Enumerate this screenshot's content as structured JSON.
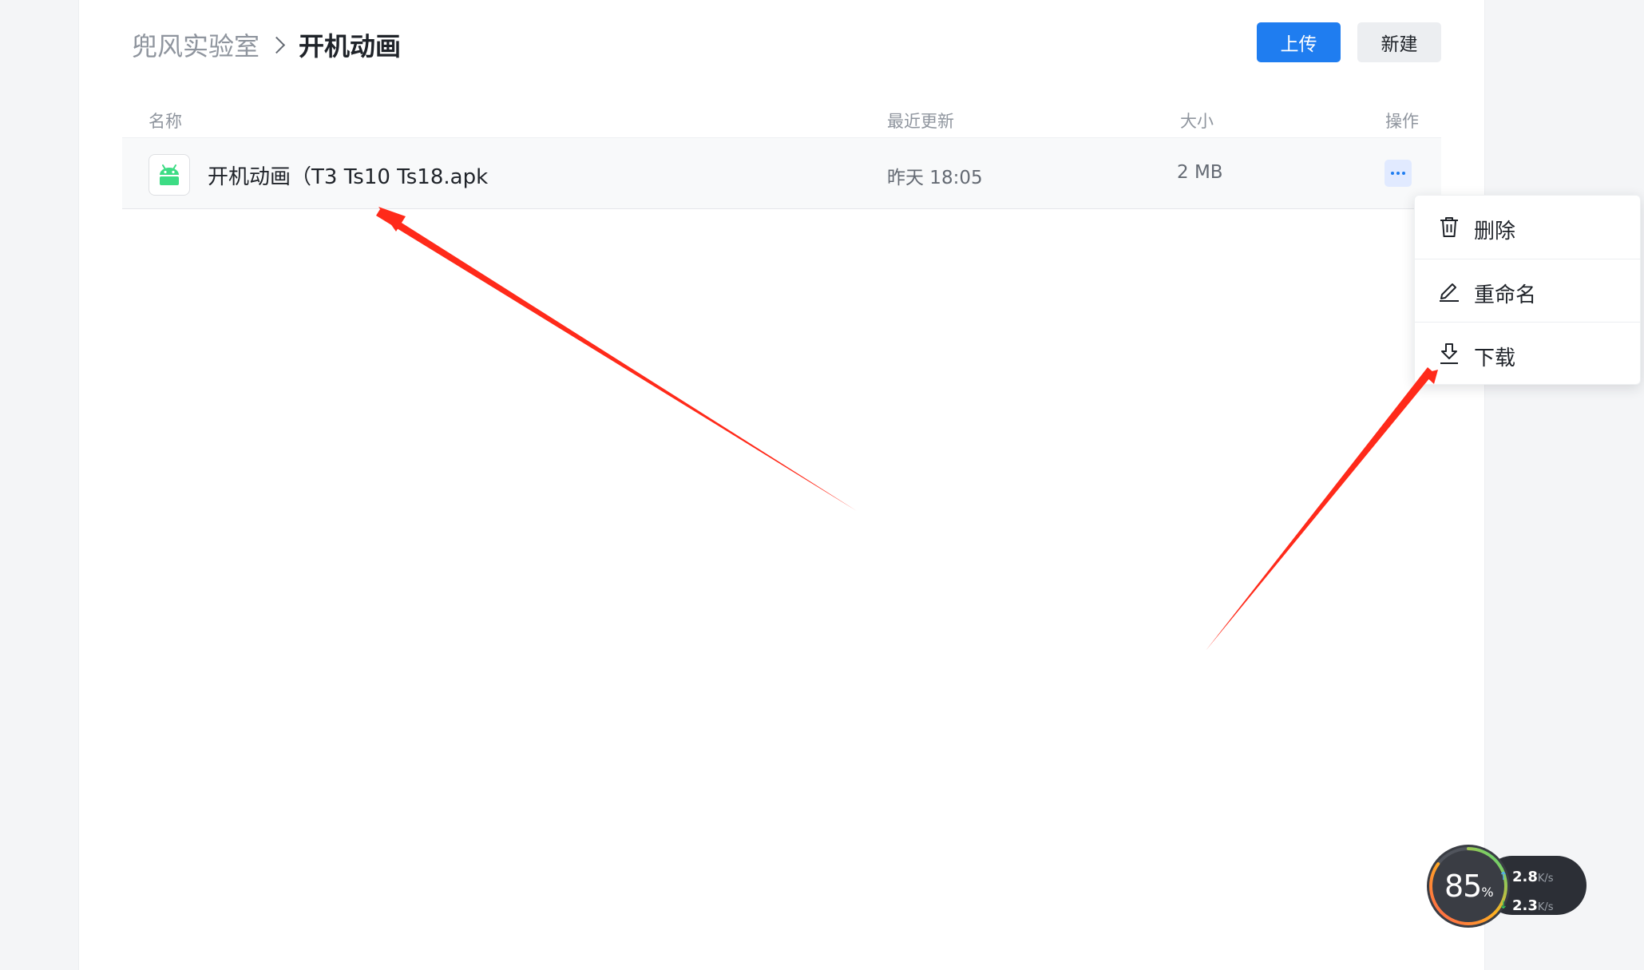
{
  "breadcrumb": {
    "parent": "兜风实验室",
    "current": "开机动画"
  },
  "toolbar": {
    "upload_label": "上传",
    "new_label": "新建"
  },
  "table": {
    "columns": {
      "name": "名称",
      "updated": "最近更新",
      "size": "大小",
      "actions": "操作"
    },
    "rows": [
      {
        "icon": "android-icon",
        "name": "开机动画（T3 Ts10 Ts18.apk",
        "updated": "昨天 18:05",
        "size": "2 MB"
      }
    ]
  },
  "context_menu": {
    "items": [
      {
        "label": "删除",
        "icon": "trash-icon"
      },
      {
        "label": "重命名",
        "icon": "pencil-icon"
      },
      {
        "label": "下载",
        "icon": "download-icon"
      }
    ]
  },
  "speed_widget": {
    "percent": "85",
    "percent_sign": "%",
    "upload_value": "2.8",
    "download_value": "2.3",
    "unit": "K/s"
  },
  "colors": {
    "primary": "#1f7df0",
    "android_green": "#3ddc84",
    "annotation_arrow": "#ff2a1a"
  }
}
